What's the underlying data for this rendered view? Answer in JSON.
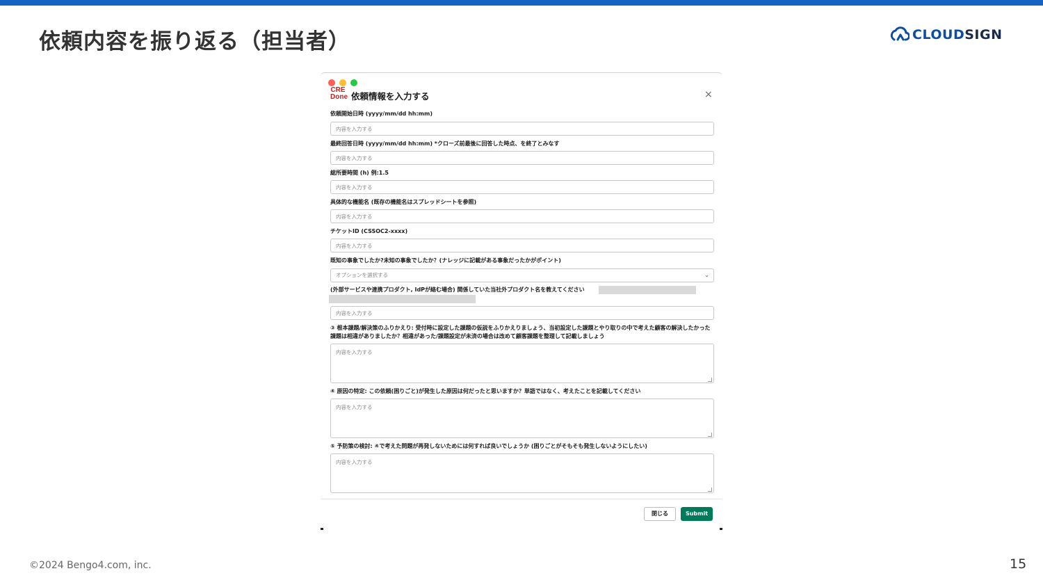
{
  "slide": {
    "title": "依頼内容を振り返る（担当者）",
    "copyright": "©2024 Bengo4.com, inc.",
    "page_number": "15",
    "accent_color": "#1565c0"
  },
  "logo": {
    "icon": "cloudsign-logo-icon",
    "text_a": "CLOUD",
    "text_b": "SIGN"
  },
  "modal": {
    "icon_line1": "CRE",
    "icon_line2": "Done",
    "title": "依頼情報を入力する",
    "close_glyph": "×",
    "placeholder": "内容を入力する",
    "fields": {
      "start": {
        "label": "依頼開始日時 (yyyy/mm/dd hh:mm)"
      },
      "last_answer": {
        "label": "最終回答日時 (yyyy/mm/dd hh:mm) *クローズ前最後に回答した時点、を終了とみなす"
      },
      "total_hours": {
        "label": "総所要時間 (h) 例:1.5"
      },
      "feature_name": {
        "label": "具体的な機能名 (既存の機能名はスプレッドシートを参照)"
      },
      "ticket_id": {
        "label": "チケットID (CSSOC2-xxxx)"
      },
      "known_issue": {
        "label": "既知の事象でしたか?未知の事象でしたか？(ナレッジに記載がある事象だったかがポイント)",
        "selected": "オプションを選択する"
      },
      "external_product": {
        "label": "(外部サービスや連携プロダクト, IdPが絡む場合) 関係していた当社外プロダクト名を教えてください"
      },
      "root_issue": {
        "label": "③ 根本課題/解決策のふりかえり: 受付時に設定した課題の仮説をふりかえりましょう、当初設定した課題とやり取りの中で考えた顧客の解決したかった課題は相違がありましたか？相違があった/課題設定が未済の場合は改めて顧客課題を整理して記載しましょう"
      },
      "cause": {
        "label": "④ 原因の特定: この依頼(困りごと)が発生した原因は何だったと思いますか？単語ではなく、考えたことを記載してください"
      },
      "prevention": {
        "label": "⑤ 予防策の検討: ④で考えた問題が再発しないためには何すれば良いでしょうか (困りごとがそもそも発生しないようにしたい)"
      }
    },
    "buttons": {
      "close": "閉じる",
      "submit": "Submit"
    },
    "submit_color": "#007a5a"
  }
}
